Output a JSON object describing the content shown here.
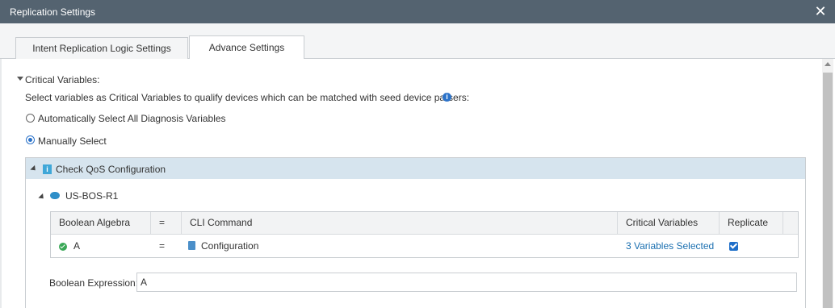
{
  "window": {
    "title": "Replication Settings"
  },
  "tabs": [
    {
      "label": "Intent Replication Logic Settings",
      "active": false
    },
    {
      "label": "Advance Settings",
      "active": true
    }
  ],
  "section": {
    "label": "Critical Variables:",
    "description": "Select variables as Critical Variables to qualify devices which can be matched with seed device parsers:",
    "options": [
      {
        "label": "Automatically Select All Diagnosis Variables",
        "selected": false
      },
      {
        "label": "Manually Select",
        "selected": true
      }
    ]
  },
  "panel": {
    "title": "Check QoS Configuration",
    "device": "US-BOS-R1",
    "grid": {
      "headers": [
        "Boolean Algebra",
        "=",
        "CLI Command",
        "Critical Variables",
        "Replicate"
      ],
      "rows": [
        {
          "algebra": "A",
          "eq": "=",
          "cli": "Configuration",
          "critical": "3 Variables Selected",
          "replicate": true
        }
      ]
    },
    "boolean_expression": {
      "label": "Boolean Expression:",
      "value": "A"
    }
  },
  "colors": {
    "titlebar": "#546370",
    "accent": "#2c73c9",
    "panel_header": "#d6e4ee",
    "link": "#1a6fb0",
    "success": "#3aa857"
  }
}
